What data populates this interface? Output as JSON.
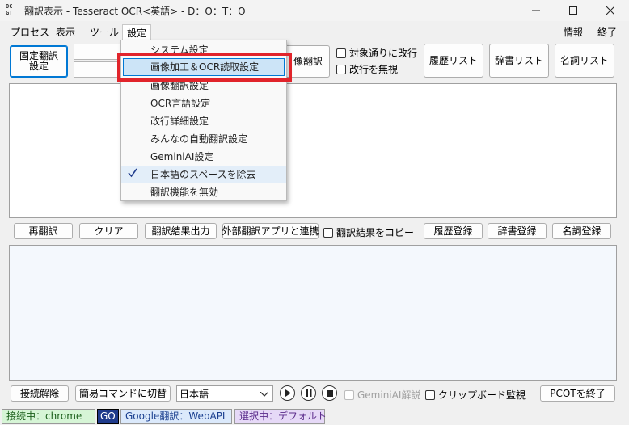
{
  "window": {
    "title": "翻訳表示 - Tesseract OCR<英語> - D：O：T：O",
    "icon_text": "OC\nGT",
    "controls": [
      "minimize-icon",
      "maximize-icon",
      "close-icon"
    ]
  },
  "menubar": {
    "process": "プロセス",
    "view": "表示",
    "tools": "ツール",
    "settings": "設定",
    "info": "情報",
    "exit": "終了"
  },
  "settings_menu": {
    "items": [
      {
        "label": "システム設定"
      },
      {
        "label": "画像加工＆OCR読取設定",
        "highlighted": true
      },
      {
        "label": "画像翻訳設定"
      },
      {
        "label": "OCR言語設定"
      },
      {
        "label": "改行詳細設定"
      },
      {
        "label": "みんなの自動翻訳設定"
      },
      {
        "label": "GeminiAI設定"
      },
      {
        "label": "日本語のスペースを除去",
        "checked": true
      },
      {
        "label": "翻訳機能を無効"
      }
    ]
  },
  "toolbar": {
    "fixed_translation": "固定翻訳\n設定",
    "image_translation": "像翻訳",
    "break_per_target": "対象通りに改行",
    "ignore_breaks": "改行を無視",
    "history_list": "履歴リスト",
    "dictionary_list": "辞書リスト",
    "noun_list": "名詞リスト"
  },
  "action_bar": {
    "retranslate": "再翻訳",
    "clear": "クリア",
    "output_results": "翻訳結果出力",
    "external_app": "外部翻訳アプリと連携",
    "copy_results": "翻訳結果をコピー",
    "history_register": "履歴登録",
    "dictionary_register": "辞書登録",
    "noun_register": "名詞登録"
  },
  "bottom_bar": {
    "disconnect": "接続解除",
    "switch_simple": "簡易コマンドに切替",
    "language": "日本語",
    "gemini_explain": "GeminiAI解説",
    "clipboard_watch": "クリップボード監視",
    "quit_pcot": "PCOTを終了"
  },
  "statusbar": {
    "connection": "接続中：chrome",
    "go": "GO",
    "engine": "Google翻訳：WebAPI",
    "selection": "選択中：デフォルト"
  },
  "colors": {
    "highlight_frame": "#e1242b",
    "menu_highlight": "#cce4f7",
    "status_green": "#d6f5d6",
    "status_blue": "#dbe9fb",
    "status_purple": "#e6d9f7",
    "go_bg": "#1f3b8c"
  }
}
